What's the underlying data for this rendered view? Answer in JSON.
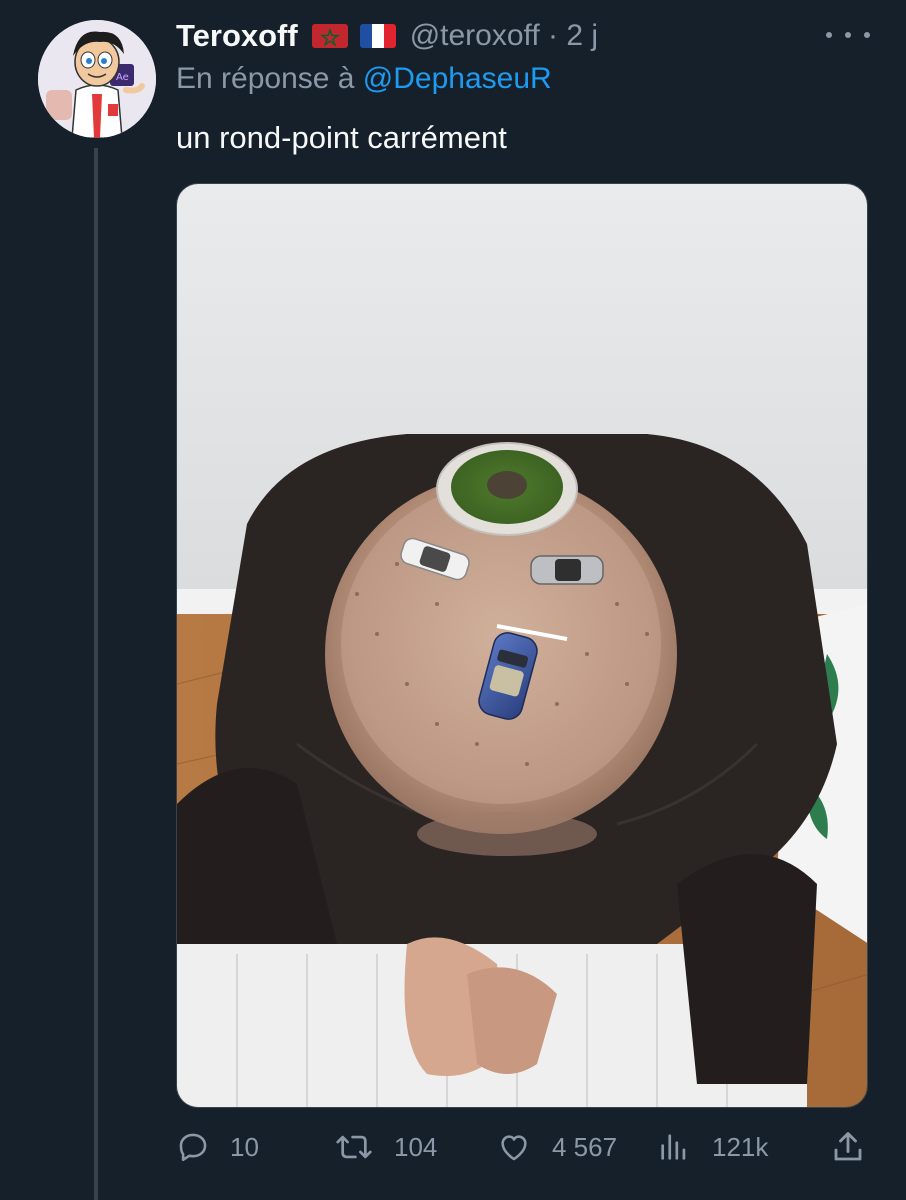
{
  "author": {
    "display_name": "Teroxoff",
    "flags": [
      "morocco-flag",
      "france-flag"
    ],
    "handle_time": "@teroxoff · 2 j",
    "avatar": "cartoon-avatar"
  },
  "reply": {
    "prefix": "En réponse à ",
    "mention": "@DephaseuR"
  },
  "tweet": {
    "text": "un rond-point carrément"
  },
  "media": {
    "image": "photo-head-roundabout"
  },
  "actions": {
    "reply_count": "10",
    "retweet_count": "104",
    "like_count": "4 567",
    "views_count": "121k"
  },
  "colors": {
    "background": "#15202b",
    "text_primary": "#f7f9f9",
    "text_secondary": "#8b98a5",
    "accent": "#1d9bf0"
  }
}
